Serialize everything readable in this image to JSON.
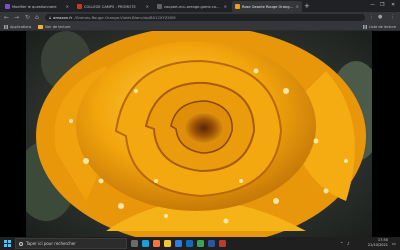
{
  "tabs": [
    {
      "title": "Modifier le questionnaire",
      "active": false,
      "color": "#7b4cd9"
    },
    {
      "title": "COLLEGE CAMPS : PROMOTE",
      "active": false,
      "color": "#d93025"
    },
    {
      "title": "coupart-ecu.orange.game.com/ff",
      "active": false,
      "color": "#5f6368"
    },
    {
      "title": "Rose Geante Rouge Orange Bla",
      "active": true,
      "color": "#ff9900"
    }
  ],
  "browser": {
    "new_tab": "+",
    "address_domain": "amazon.fr",
    "address_path": "/Graines-Rouge-Orange-Violet-Blanc/dp/B012XYZ45M",
    "bookmarks": [
      {
        "label": "Applications",
        "icon": "apps-grid-icon"
      },
      {
        "label": "Voir de lecture",
        "icon": "folder-icon"
      }
    ],
    "reading_list": "Liste de lecture"
  },
  "taskbar": {
    "search_placeholder": "Taper ici pour rechercher",
    "apps": [
      {
        "name": "task-view-icon",
        "color": "#6b6b6b"
      },
      {
        "name": "edge-icon",
        "color": "#1a9fd9"
      },
      {
        "name": "firefox-icon",
        "color": "#ff7139"
      },
      {
        "name": "file-explorer-icon",
        "color": "#f3c13a"
      },
      {
        "name": "store-icon",
        "color": "#2d7de0"
      },
      {
        "name": "mail-icon",
        "color": "#0f6cbd"
      },
      {
        "name": "chrome-icon",
        "color": "#34a853"
      },
      {
        "name": "word-icon",
        "color": "#2b579a"
      },
      {
        "name": "app-icon",
        "color": "#c0392b"
      }
    ],
    "time": "17:50",
    "date": "21/10/2021"
  },
  "colors": {
    "rose_main": "#f2a50c",
    "rose_dark": "#b8650a",
    "rose_light": "#ffd04a"
  }
}
